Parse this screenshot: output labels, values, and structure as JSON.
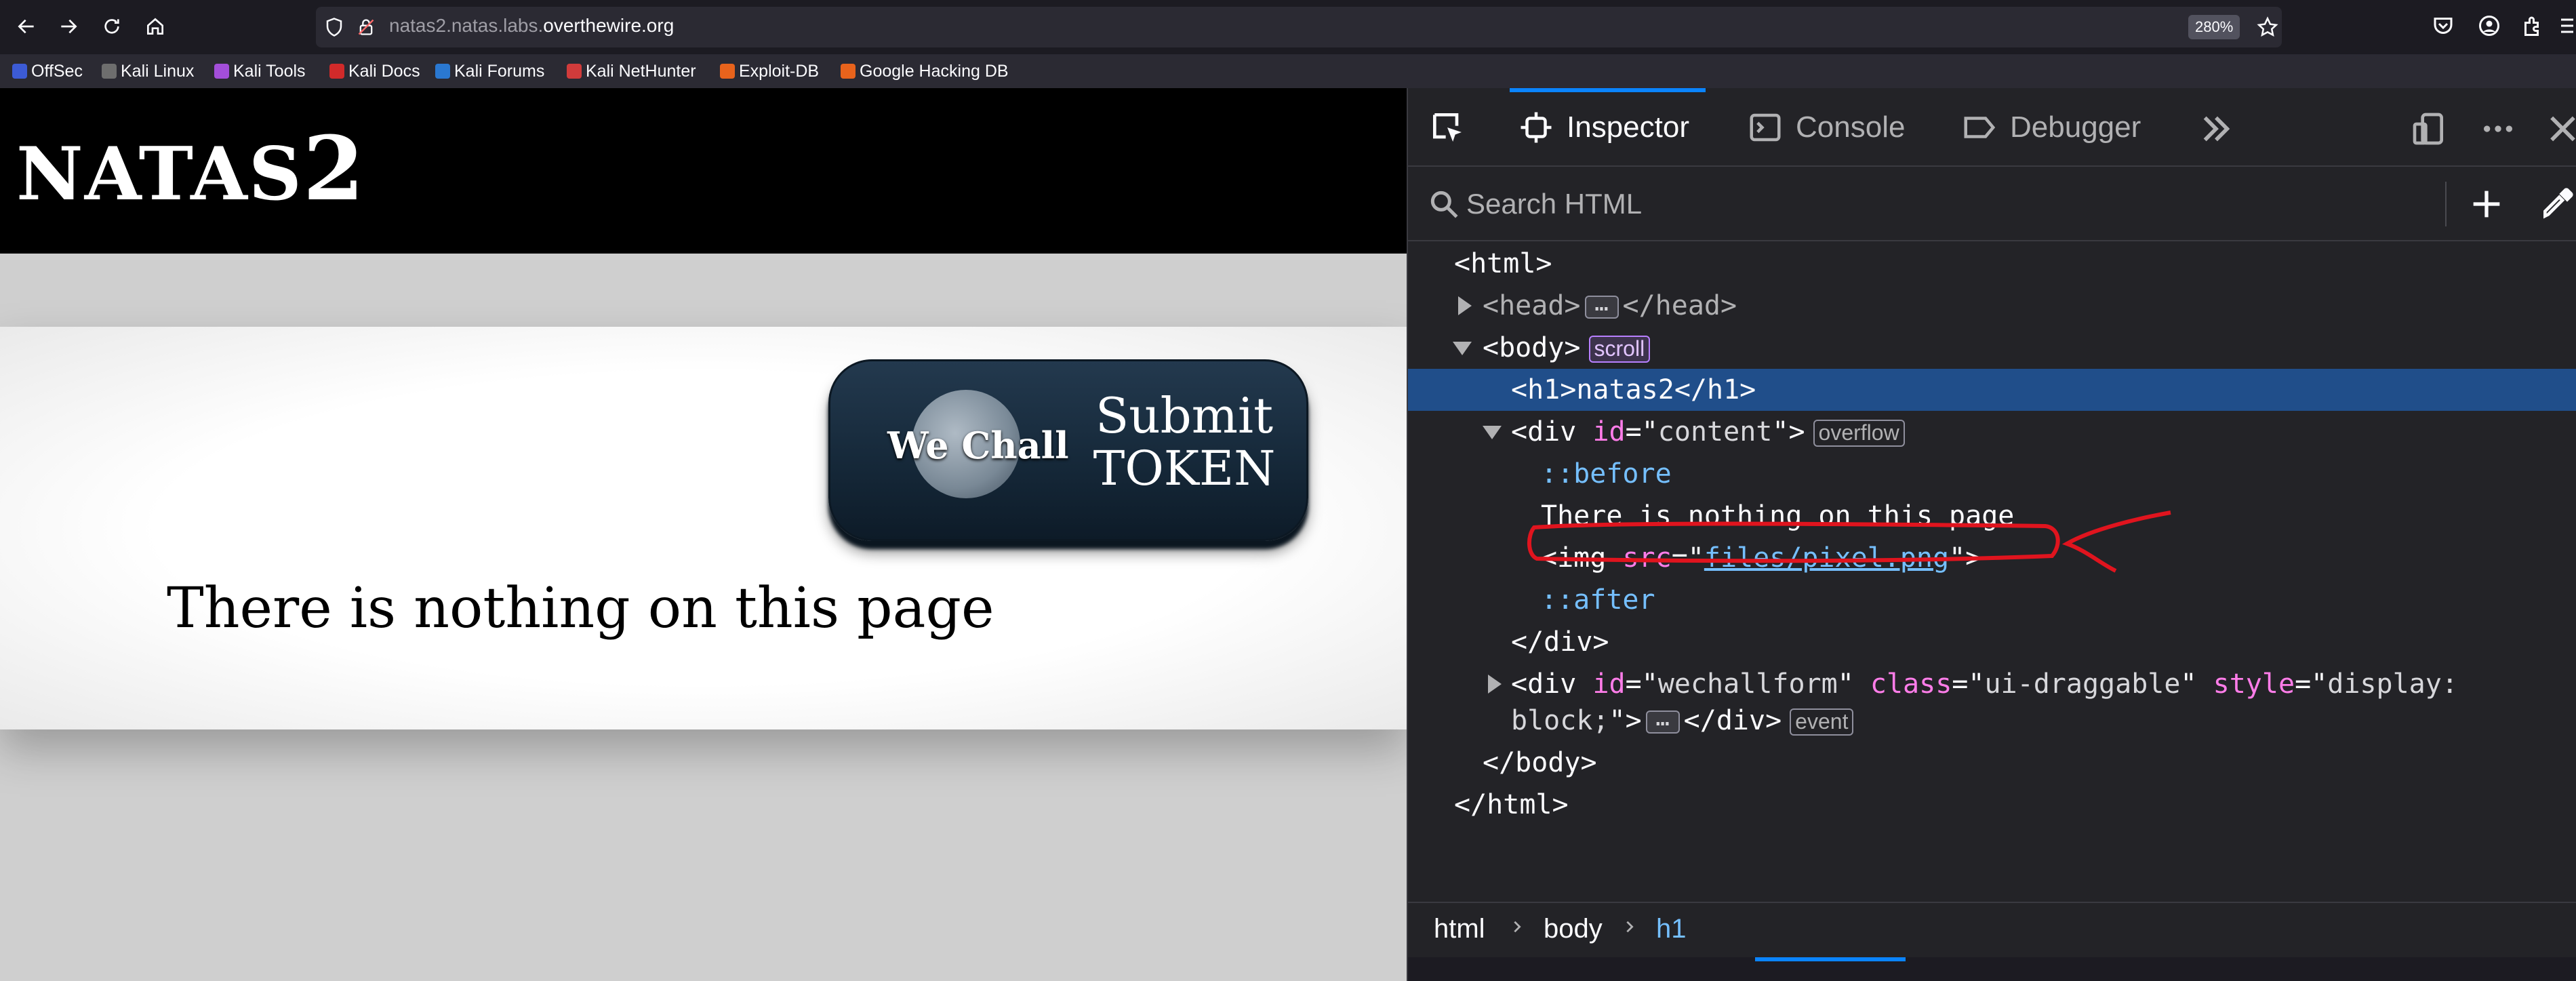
{
  "browser": {
    "url_prefix": "natas2.natas.labs.",
    "url_domain": "overthewire.org",
    "zoom": "280%",
    "bookmarks": [
      "OffSec",
      "Kali Linux",
      "Kali Tools",
      "Kali Docs",
      "Kali Forums",
      "Kali NetHunter",
      "Exploit-DB",
      "Google Hacking DB"
    ],
    "accent": "#0a84ff"
  },
  "page": {
    "title_main": "NATAS",
    "title_number": "2",
    "content_text": "There is nothing on this page",
    "wechall_logo": "We Chall",
    "wechall_submit": "Submit",
    "wechall_token": "TOKEN"
  },
  "devtools": {
    "tabs": [
      "Inspector",
      "Console",
      "Debugger"
    ],
    "search_placeholder": "Search HTML",
    "tree": {
      "html_open": "<html>",
      "head_open": "<head>",
      "head_close": "</head>",
      "body_open": "<body>",
      "scroll_badge": "scroll",
      "h1": "<h1>natas2</h1>",
      "div_tag": "div",
      "id_attr": "id",
      "content_val": "content",
      "overflow_badge": "overflow",
      "before": "::before",
      "text_node": "There is nothing on this page",
      "img_tag": "img",
      "src_attr": "src",
      "src_val": "files/pixel.png",
      "after": "::after",
      "div_close": "</div>",
      "wechall_val": "wechallform",
      "class_attr": "class",
      "class_val": "ui-draggable",
      "style_attr": "style",
      "style_val_1": "display:",
      "style_val_2": "block;",
      "event_badge": "event",
      "body_close": "</body>",
      "html_close": "</html>"
    },
    "breadcrumbs": [
      "html",
      "body",
      "h1"
    ],
    "annotation_color": "#e0141e"
  }
}
